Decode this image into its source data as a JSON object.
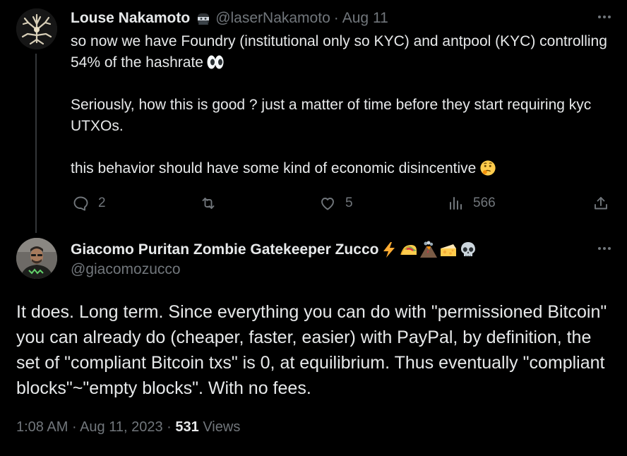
{
  "tweet1": {
    "author_name": "Louse Nakamoto",
    "author_handle": "@laserNakamoto",
    "separator": "·",
    "date": "Aug 11",
    "body_p1": "so now we have Foundry (institutional only so KYC) and antpool (KYC) controlling 54% of the hashrate",
    "body_p2": "Seriously, how this is good ? just a matter of time before they start requiring kyc UTXOs.",
    "body_p3": "this behavior should have some kind of economic disincentive",
    "icons": {
      "name_badge": "ninja-emoji-icon",
      "eyes": "eyes-emoji-icon",
      "thinking": "thinking-face-emoji-icon"
    },
    "actions": {
      "replies": "2",
      "reposts": "",
      "likes": "5",
      "views": "566"
    }
  },
  "tweet2": {
    "author_name": "Giacomo Puritan Zombie Gatekeeper Zucco",
    "author_handle": "@giacomozucco",
    "name_emojis": [
      "lightning-emoji-icon",
      "taco-emoji-icon",
      "volcano-emoji-icon",
      "cheese-emoji-icon",
      "skull-emoji-icon"
    ],
    "body": "It does. Long term. Since everything you can do with \"permissioned Bitcoin\" you can already do (cheaper, faster, easier) with PayPal, by definition, the set of \"compliant Bitcoin txs\" is 0, at equilibrium. Thus eventually \"compliant blocks\"~\"empty blocks\". With no fees.",
    "time": "1:08 AM",
    "separator": "·",
    "date": "Aug 11, 2023",
    "view_count": "531",
    "views_label": "Views"
  },
  "colors": {
    "background": "#000000",
    "text_primary": "#e7e9ea",
    "text_secondary": "#71767b",
    "thread_line": "#333639"
  }
}
